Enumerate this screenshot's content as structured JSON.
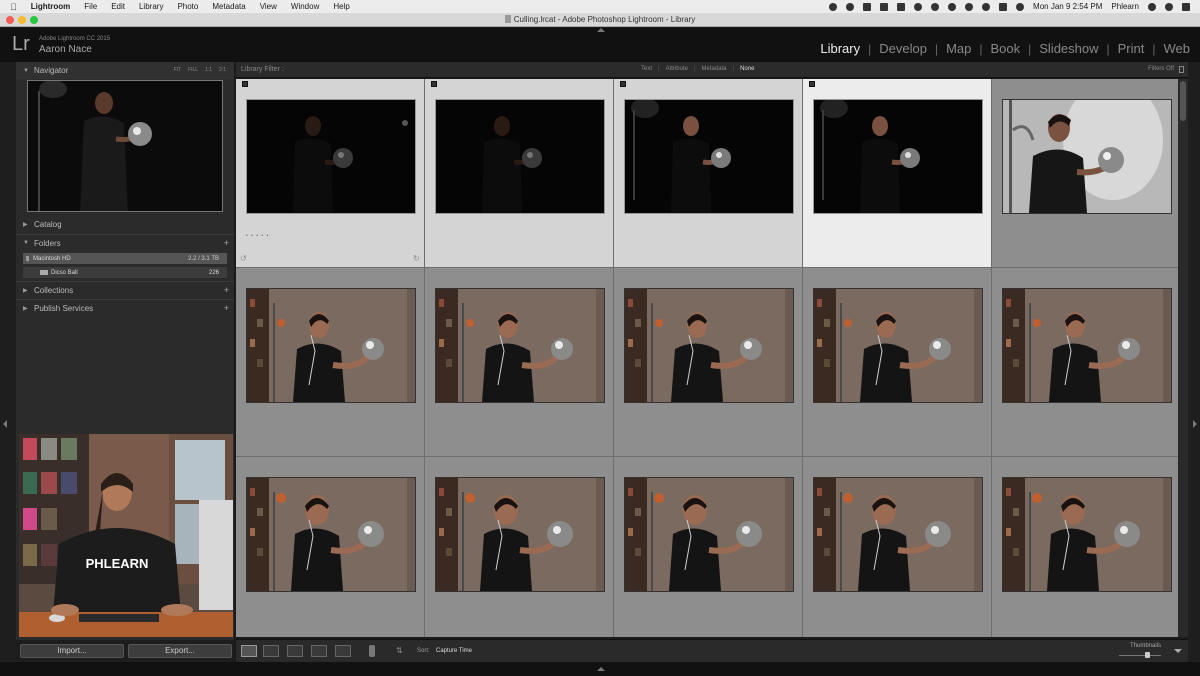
{
  "menubar": {
    "app": "Lightroom",
    "items": [
      "File",
      "Edit",
      "Library",
      "Photo",
      "Metadata",
      "View",
      "Window",
      "Help"
    ],
    "clock": "Mon Jan 9  2:54 PM",
    "user": "Phlearn"
  },
  "window": {
    "title": "Culling.lrcat - Adobe Photoshop Lightroom - Library"
  },
  "identity": {
    "logo": "Lr",
    "app_name": "Adobe Lightroom CC 2015",
    "user_name": "Aaron Nace"
  },
  "modules": [
    {
      "label": "Library",
      "active": true
    },
    {
      "label": "Develop",
      "active": false
    },
    {
      "label": "Map",
      "active": false
    },
    {
      "label": "Book",
      "active": false
    },
    {
      "label": "Slideshow",
      "active": false
    },
    {
      "label": "Print",
      "active": false
    },
    {
      "label": "Web",
      "active": false
    }
  ],
  "left_panel": {
    "navigator": {
      "title": "Navigator",
      "zoom_options": [
        "FIT",
        "FILL",
        "1:1",
        "2:1"
      ]
    },
    "catalog": {
      "title": "Catalog"
    },
    "folders": {
      "title": "Folders",
      "volume": {
        "name": "Macintosh HD",
        "size": "2.2 / 3.1 TB"
      },
      "items": [
        {
          "name": "Dicso Ball",
          "count": "226"
        }
      ]
    },
    "collections": {
      "title": "Collections"
    },
    "publish_services": {
      "title": "Publish Services"
    },
    "buttons": {
      "import": "Import...",
      "export": "Export..."
    }
  },
  "webcam_overlay": {
    "shirt_text": "PHLEARN"
  },
  "filter_bar": {
    "title": "Library Filter :",
    "options": [
      "Text",
      "Attribute",
      "Metadata",
      "None"
    ],
    "active_option": "None",
    "status": "Filters Off"
  },
  "grid": {
    "columns": 5,
    "rows": [
      [
        {
          "style": "dark",
          "selected": true,
          "primary": false
        },
        {
          "style": "dark",
          "selected": true,
          "primary": false
        },
        {
          "style": "dark-lit",
          "selected": true,
          "primary": false
        },
        {
          "style": "dark-lit",
          "selected": true,
          "primary": true
        },
        {
          "style": "bright",
          "selected": false,
          "primary": false
        }
      ],
      [
        {
          "style": "studio",
          "selected": false,
          "primary": false
        },
        {
          "style": "studio",
          "selected": false,
          "primary": false
        },
        {
          "style": "studio",
          "selected": false,
          "primary": false
        },
        {
          "style": "studio",
          "selected": false,
          "primary": false
        },
        {
          "style": "studio",
          "selected": false,
          "primary": false
        }
      ],
      [
        {
          "style": "studio-close",
          "selected": false,
          "primary": false
        },
        {
          "style": "studio-close",
          "selected": false,
          "primary": false
        },
        {
          "style": "studio-close",
          "selected": false,
          "primary": false
        },
        {
          "style": "studio-close",
          "selected": false,
          "primary": false
        },
        {
          "style": "studio-close",
          "selected": false,
          "primary": false
        }
      ]
    ]
  },
  "toolbar": {
    "views": [
      "grid-view-icon",
      "loupe-view-icon",
      "compare-view-icon",
      "survey-view-icon",
      "people-view-icon"
    ],
    "sort_label": "Sort:",
    "sort_value": "Capture Time",
    "thumbnails_label": "Thumbnails"
  },
  "colors": {
    "accent_active": "#ececec",
    "grid_bg": "#8e8e8e",
    "selected_cell": "#d4d4d4",
    "primary_cell": "#ececec"
  }
}
